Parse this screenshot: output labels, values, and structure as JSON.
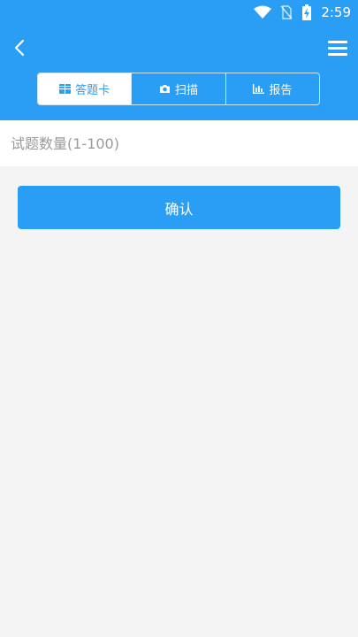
{
  "status_bar": {
    "time": "2:59",
    "icons": [
      "wifi-icon",
      "no-sim-icon",
      "battery-charging-icon"
    ]
  },
  "header": {
    "back_icon": "chevron-left-icon",
    "menu_icon": "hamburger-menu-icon",
    "background_color": "#2a9df4"
  },
  "tabs": [
    {
      "label": "答题卡",
      "icon": "grid-card-icon",
      "active": true
    },
    {
      "label": "扫描",
      "icon": "camera-icon",
      "active": false
    },
    {
      "label": "报告",
      "icon": "bar-chart-icon",
      "active": false
    }
  ],
  "form": {
    "question_count_placeholder": "试题数量(1-100)",
    "question_count_value": ""
  },
  "actions": {
    "confirm_label": "确认"
  }
}
